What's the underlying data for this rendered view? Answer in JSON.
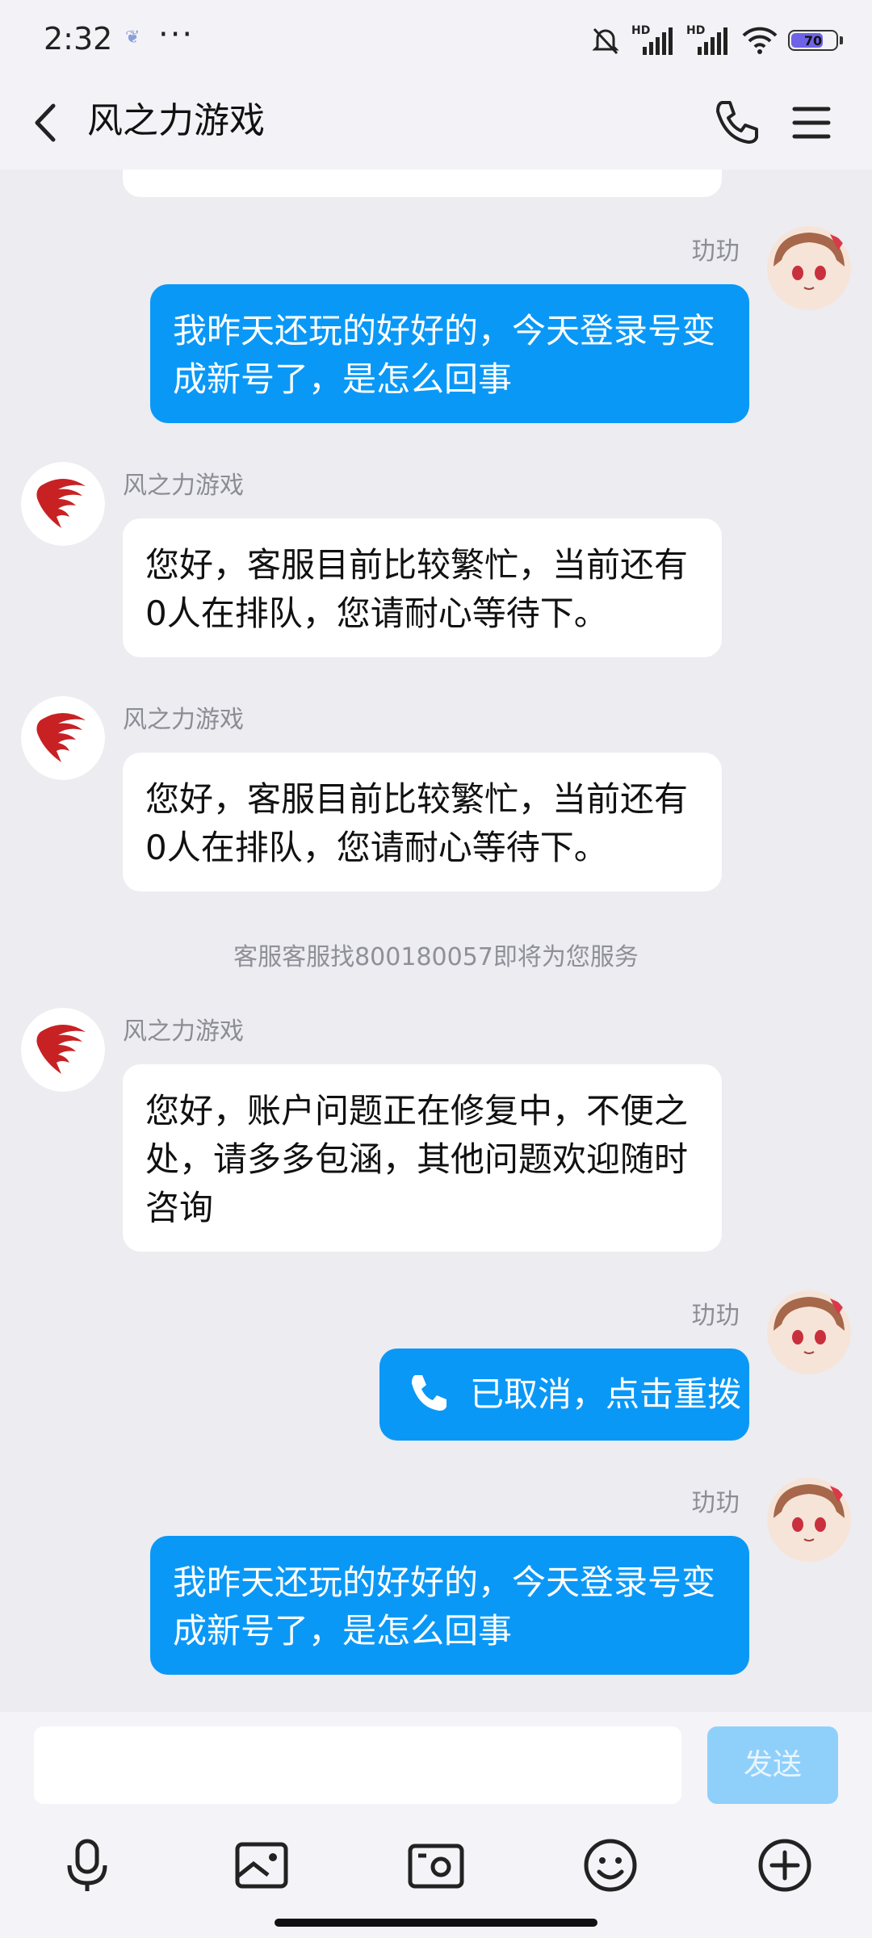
{
  "status_bar": {
    "time": "2:32",
    "more": "···",
    "battery": "70",
    "signal_label": "HD"
  },
  "header": {
    "title": "风之力游戏"
  },
  "messages": {
    "m1": {
      "sender": "玏玏",
      "text": "我昨天还玩的好好的，今天登录号变成新号了，是怎么回事"
    },
    "m2": {
      "sender": "风之力游戏",
      "text": "您好，客服目前比较繁忙，当前还有0人在排队，您请耐心等待下。"
    },
    "m3": {
      "sender": "风之力游戏",
      "text": "您好，客服目前比较繁忙，当前还有0人在排队，您请耐心等待下。"
    },
    "sys": {
      "text": "客服客服找800180057即将为您服务"
    },
    "m4": {
      "sender": "风之力游戏",
      "text": "您好，账户问题正在修复中，不便之处，请多多包涵，其他问题欢迎随时咨询"
    },
    "m5": {
      "sender": "玏玏",
      "text": "已取消，点击重拨"
    },
    "m6": {
      "sender": "玏玏",
      "text": "我昨天还玩的好好的，今天登录号变成新号了，是怎么回事"
    }
  },
  "input_bar": {
    "placeholder": "",
    "send_label": "发送"
  },
  "colors": {
    "bubble_right": "#0a98f7",
    "bubble_left": "#ffffff",
    "background": "#ececf1",
    "send_disabled": "#8fd0fb"
  },
  "icons": [
    "back-icon",
    "phone-icon",
    "menu-icon",
    "voice-icon",
    "image-icon",
    "camera-icon",
    "emoji-icon",
    "plus-icon"
  ]
}
